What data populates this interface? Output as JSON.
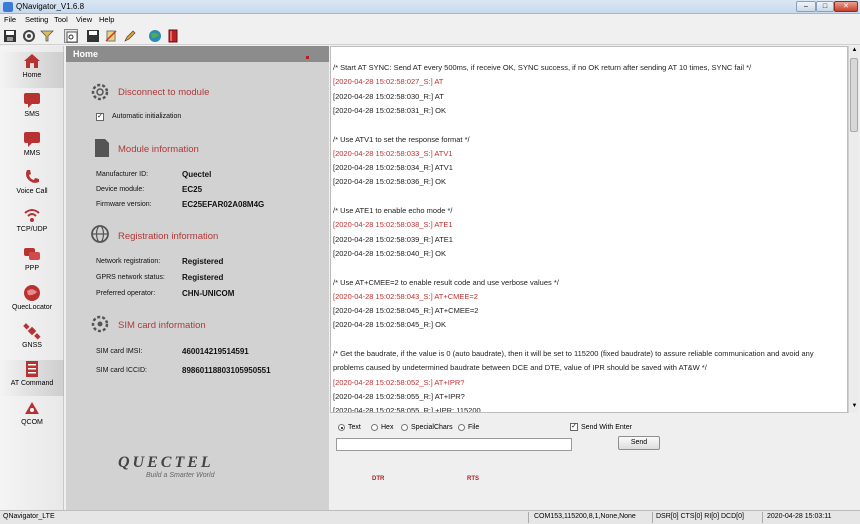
{
  "window": {
    "title": "QNavigator_V1.6.8",
    "controls": [
      "–",
      "□",
      "✕"
    ]
  },
  "menu": [
    "File",
    "Setting",
    "Tool",
    "View",
    "Help"
  ],
  "toolbar": [
    "save-icon",
    "settings-icon",
    "filter-icon",
    "view-icon",
    "save-log-icon",
    "clear-icon",
    "edit-icon",
    "web-icon",
    "book-icon"
  ],
  "nav": [
    {
      "label": "Home",
      "icon": "home-icon"
    },
    {
      "label": "SMS",
      "icon": "sms-icon"
    },
    {
      "label": "MMS",
      "icon": "mms-icon"
    },
    {
      "label": "Voice Call",
      "icon": "phone-icon"
    },
    {
      "label": "TCP/UDP",
      "icon": "wifi-icon"
    },
    {
      "label": "PPP",
      "icon": "ppp-icon"
    },
    {
      "label": "QuecLocator",
      "icon": "locator-icon"
    },
    {
      "label": "GNSS",
      "icon": "satellite-icon"
    },
    {
      "label": "AT Command",
      "icon": "at-command-icon"
    },
    {
      "label": "QCOM",
      "icon": "qcom-icon"
    }
  ],
  "home": {
    "header": "Home",
    "connect": {
      "title": "Disconnect to module",
      "auto_init_label": "Automatic initialization",
      "auto_init_checked": true
    },
    "module": {
      "title": "Module information",
      "rows": [
        {
          "label": "Manufacturer ID:",
          "value": "Quectel"
        },
        {
          "label": "Device module:",
          "value": "EC25"
        },
        {
          "label": "Firmware version:",
          "value": "EC25EFAR02A08M4G"
        }
      ]
    },
    "registration": {
      "title": "Registration information",
      "rows": [
        {
          "label": "Network registration:",
          "value": "Registered"
        },
        {
          "label": "GPRS network status:",
          "value": "Registered"
        },
        {
          "label": "Preferred operator:",
          "value": "CHN-UNICOM"
        }
      ]
    },
    "sim": {
      "title": "SIM card information",
      "rows": [
        {
          "label": "SIM card IMSI:",
          "value": "460014219514591"
        },
        {
          "label": "SIM card ICCID:",
          "value": "89860118803105950551"
        }
      ]
    },
    "logo": "QUECTEL",
    "slogan": "Build a Smarter World"
  },
  "console": [
    {
      "text": "/* Start AT SYNC: Send AT every 500ms, if receive OK, SYNC success, if no OK return after sending AT 10 times, SYNC fail */",
      "type": "comment"
    },
    {
      "text": "[2020-04-28 15:02:58:027_S:] AT",
      "type": "sent"
    },
    {
      "text": "[2020-04-28 15:02:58:030_R:] AT",
      "type": "recv"
    },
    {
      "text": "[2020-04-28 15:02:58:031_R:] OK",
      "type": "recv"
    },
    {
      "text": "",
      "type": "blank"
    },
    {
      "text": "/* Use ATV1 to set the response format */",
      "type": "comment"
    },
    {
      "text": "[2020-04-28 15:02:58:033_S:] ATV1",
      "type": "sent"
    },
    {
      "text": "[2020-04-28 15:02:58:034_R:] ATV1",
      "type": "recv"
    },
    {
      "text": "[2020-04-28 15:02:58:036_R:] OK",
      "type": "recv"
    },
    {
      "text": "",
      "type": "blank"
    },
    {
      "text": "/* Use ATE1 to enable echo mode */",
      "type": "comment"
    },
    {
      "text": "[2020-04-28 15:02:58:038_S:] ATE1",
      "type": "sent"
    },
    {
      "text": "[2020-04-28 15:02:58:039_R:] ATE1",
      "type": "recv"
    },
    {
      "text": "[2020-04-28 15:02:58:040_R:] OK",
      "type": "recv"
    },
    {
      "text": "",
      "type": "blank"
    },
    {
      "text": "/* Use AT+CMEE=2 to enable result code and use verbose values */",
      "type": "comment"
    },
    {
      "text": "[2020-04-28 15:02:58:043_S:] AT+CMEE=2",
      "type": "sent"
    },
    {
      "text": "[2020-04-28 15:02:58:045_R:] AT+CMEE=2",
      "type": "recv"
    },
    {
      "text": "[2020-04-28 15:02:58:045_R:] OK",
      "type": "recv"
    },
    {
      "text": "",
      "type": "blank"
    },
    {
      "text": "/* Get the baudrate, if the value is 0 (auto baudrate), then it will be set to 115200 (fixed baudrate) to assure reliable communication and avoid any",
      "type": "comment"
    },
    {
      "text": "problems caused by undetermined baudrate between DCE and DTE, value of IPR should be saved with AT&W */",
      "type": "comment"
    },
    {
      "text": "[2020-04-28 15:02:58:052_S:] AT+IPR?",
      "type": "sent"
    },
    {
      "text": "[2020-04-28 15:02:58:055_R:] AT+IPR?",
      "type": "recv"
    },
    {
      "text": "[2020-04-28 15:02:58:055_R:] +IPR: 115200",
      "type": "recv"
    }
  ],
  "send": {
    "modes": [
      {
        "label": "Text",
        "selected": true
      },
      {
        "label": "Hex",
        "selected": false
      },
      {
        "label": "SpecialChars",
        "selected": false
      },
      {
        "label": "File",
        "selected": false
      }
    ],
    "send_with_enter_label": "Send With Enter",
    "send_with_enter_checked": true,
    "input_value": "",
    "send_button": "Send",
    "dtr_label": "DTR",
    "rts_label": "RTS"
  },
  "status": {
    "app": "QNavigator_LTE",
    "port": "COM153,115200,8,1,None,None",
    "signals": "DSR[0] CTS[0] RI[0] DCD[0]",
    "datetime": "2020-04-28 15:03:11"
  },
  "colors": {
    "accent": "#b03838",
    "sent_text": "#c03030",
    "panel_header": "#8c8c8c"
  }
}
